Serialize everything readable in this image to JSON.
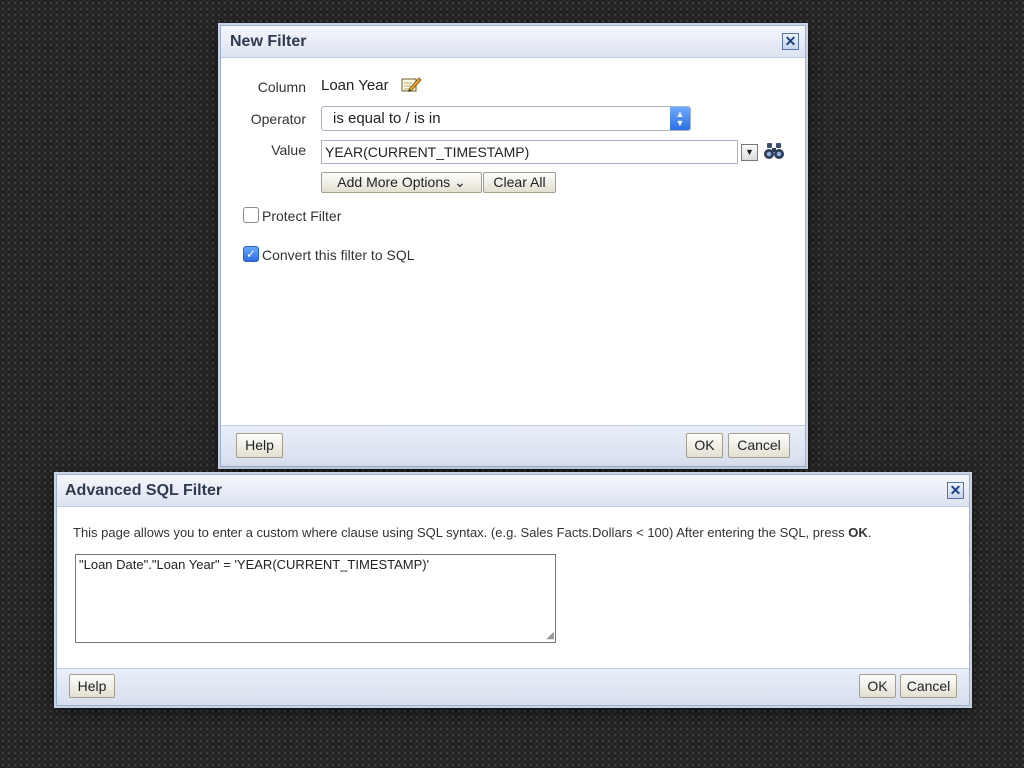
{
  "new_filter": {
    "title": "New Filter",
    "close_glyph": "✕",
    "column_label": "Column",
    "column_value": "Loan Year",
    "edit_icon": "edit-pencil-icon",
    "operator_label": "Operator",
    "operator_selected": "is equal to / is in",
    "value_label": "Value",
    "value_text": "YEAR(CURRENT_TIMESTAMP)",
    "dropdown_glyph": "▼",
    "search_icon": "binoculars-icon",
    "add_more_options_label": "Add More Options ⌄",
    "clear_all_label": "Clear All",
    "protect_filter_label": "Protect Filter",
    "protect_filter_checked": false,
    "convert_sql_label": "Convert this filter to SQL",
    "convert_sql_checked": true,
    "check_glyph": "✓",
    "help_label": "Help",
    "ok_label": "OK",
    "cancel_label": "Cancel"
  },
  "advanced_sql_filter": {
    "title": "Advanced SQL Filter",
    "close_glyph": "✕",
    "instructions_text": "This page allows you to enter a custom where clause using SQL syntax. (e.g. Sales Facts.Dollars < 100) After entering the SQL, press ",
    "instructions_bold": "OK",
    "instructions_end": ".",
    "sql_text": "\"Loan Date\".\"Loan Year\" = 'YEAR(CURRENT_TIMESTAMP)'",
    "help_label": "Help",
    "ok_label": "OK",
    "cancel_label": "Cancel"
  },
  "colors": {
    "accent_blue": "#2c6fe0",
    "dialog_header": "#dde3f1",
    "title_text": "#2e3a4e",
    "background": "#1e1e1e"
  }
}
